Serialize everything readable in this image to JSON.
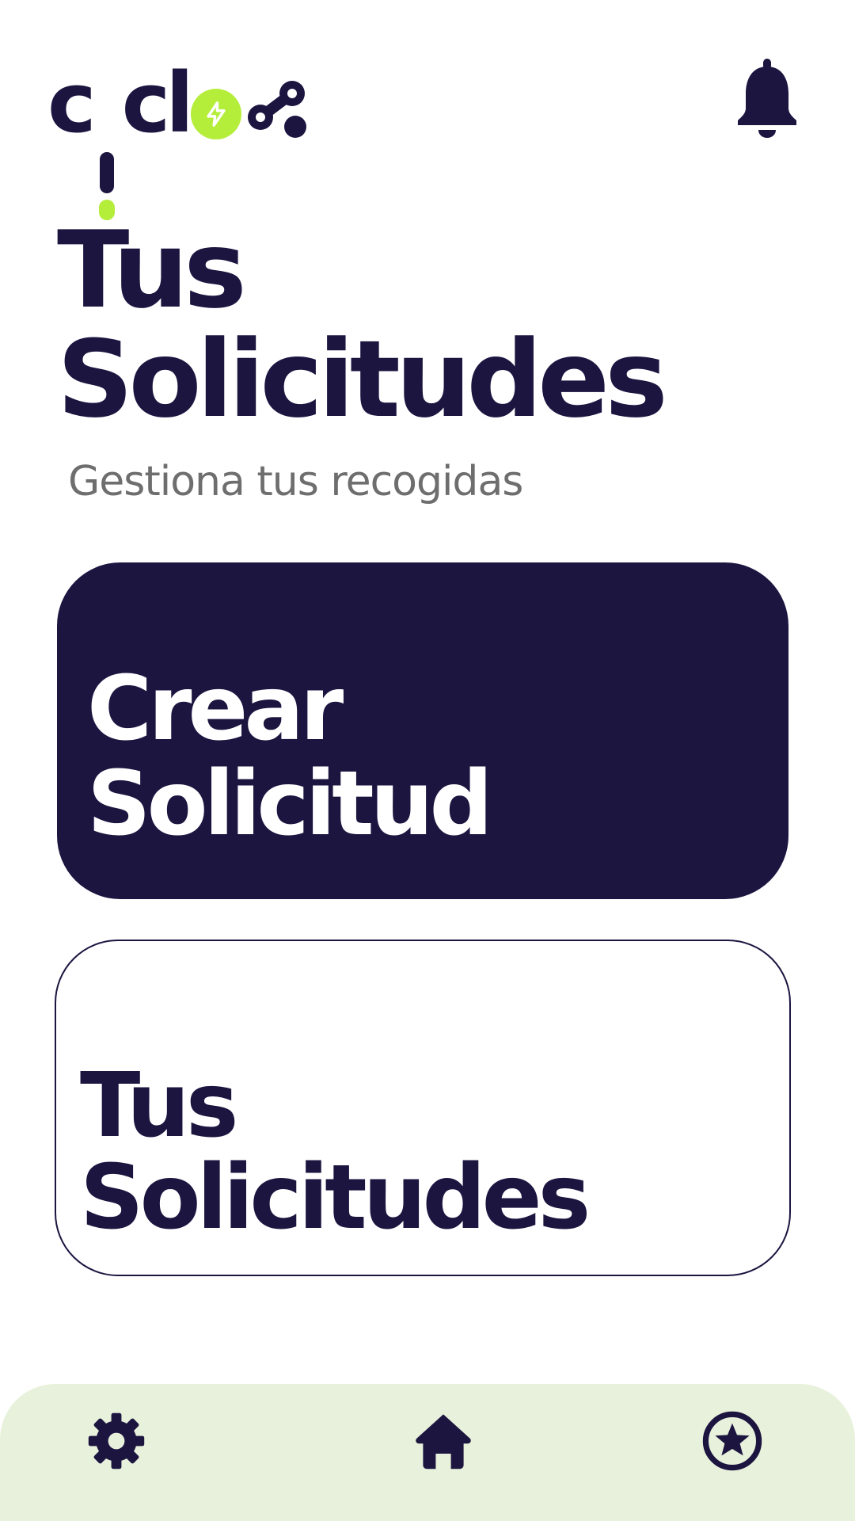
{
  "app": {
    "logo_text": "ciclo",
    "brand_colors": {
      "primary": "#1b1540",
      "accent": "#b5ee3a",
      "nav_background": "#e8f1db",
      "subtitle": "#6e6e6e"
    }
  },
  "header": {
    "logo_icon": "ciclo-logo",
    "notification_icon": "bell-icon"
  },
  "page": {
    "title_line1": "Tus",
    "title_line2": "Solicitudes",
    "subtitle": "Gestiona tus recogidas"
  },
  "cards": {
    "create": {
      "line1": "Crear",
      "line2": "Solicitud"
    },
    "list": {
      "line1": "Tus",
      "line2": "Solicitudes"
    }
  },
  "bottom_nav": {
    "items": [
      {
        "icon": "gear-icon"
      },
      {
        "icon": "home-icon"
      },
      {
        "icon": "star-badge-icon"
      }
    ]
  }
}
